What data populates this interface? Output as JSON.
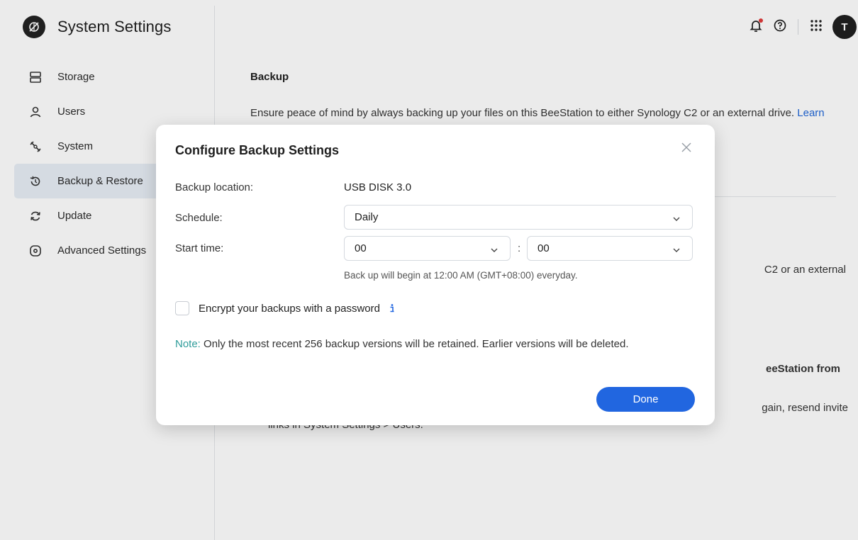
{
  "app": {
    "title": "System Settings",
    "user_initial": "T"
  },
  "sidebar": {
    "items": [
      {
        "label": "Storage",
        "icon": "storage-icon"
      },
      {
        "label": "Users",
        "icon": "user-icon"
      },
      {
        "label": "System",
        "icon": "wrench-icon"
      },
      {
        "label": "Backup & Restore",
        "icon": "restore-icon",
        "active": true
      },
      {
        "label": "Update",
        "icon": "update-icon"
      },
      {
        "label": "Advanced Settings",
        "icon": "advanced-icon"
      }
    ]
  },
  "topbar": {
    "icons": [
      "bell-icon",
      "help-icon",
      "apps-grid-icon",
      "avatar"
    ]
  },
  "main": {
    "section_title": "Backup",
    "section_desc": "Ensure peace of mind by always backing up your files on this BeeStation to either Synology C2 or an external drive.",
    "learn_more": "Learn more",
    "bg_text_1": "C2 or an external",
    "bg_text_2": "eeStation from",
    "bg_text_3": "gain, resend invite",
    "bg_text_4": "links in System Settings > Users."
  },
  "dialog": {
    "title": "Configure Backup Settings",
    "location_label": "Backup location:",
    "location_value": "USB DISK 3.0",
    "schedule_label": "Schedule:",
    "schedule_value": "Daily",
    "start_time_label": "Start time:",
    "hour_value": "00",
    "minute_value": "00",
    "time_separator": ":",
    "hint": "Back up will begin at 12:00 AM (GMT+08:00) everyday.",
    "encrypt_label": "Encrypt your backups with a password",
    "encrypt_checked": false,
    "note_prefix": "Note:",
    "note_text": " Only the most recent 256 backup versions will be retained. Earlier versions will be deleted.",
    "done_label": "Done"
  },
  "colors": {
    "accent": "#2166e0",
    "note": "#2e9c9a",
    "active_nav_bg": "#e8eef6",
    "notification_dot": "#e03a3a"
  }
}
